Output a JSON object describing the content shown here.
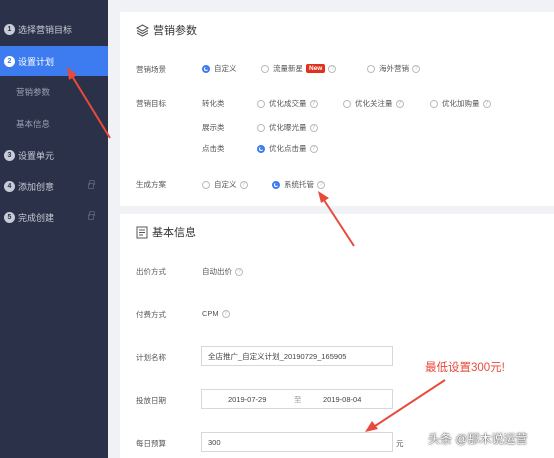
{
  "sidebar": {
    "items": [
      {
        "num": "1",
        "label": "选择营销目标"
      },
      {
        "num": "2",
        "label": "设置计划"
      },
      {
        "num": "3",
        "label": "设置单元"
      },
      {
        "num": "4",
        "label": "添加创意"
      },
      {
        "num": "5",
        "label": "完成创建"
      }
    ],
    "subitems": [
      {
        "label": "营销参数"
      },
      {
        "label": "基本信息"
      }
    ]
  },
  "marketing_params": {
    "title": "营销参数",
    "scene": {
      "label": "营销场景",
      "options": [
        {
          "label": "自定义",
          "checked": true
        },
        {
          "label": "流量新星",
          "checked": false,
          "badge": "New"
        },
        {
          "label": "海外营销",
          "checked": false
        }
      ]
    },
    "goal": {
      "label": "营销目标",
      "groups": [
        {
          "name": "转化类",
          "options": [
            "优化成交量",
            "优化关注量",
            "优化加购量"
          ]
        },
        {
          "name": "展示类",
          "options": [
            "优化曝光量"
          ]
        },
        {
          "name": "点击类",
          "options": [
            "优化点击量"
          ],
          "checked_index": 0
        }
      ]
    },
    "plan": {
      "label": "生成方案",
      "options": [
        {
          "label": "自定义",
          "checked": false
        },
        {
          "label": "系统托管",
          "checked": true
        }
      ]
    }
  },
  "basic_info": {
    "title": "基本信息",
    "bid_label": "出价方式",
    "bid_value": "自动出价",
    "pay_label": "付费方式",
    "pay_value": "CPM",
    "plan_name_label": "计划名称",
    "plan_name_value": "全店推广_自定义计划_20190729_165905",
    "date_label": "投放日期",
    "date_start": "2019-07-29",
    "date_sep": "至",
    "date_end": "2019-08-04",
    "budget_label": "每日预算",
    "budget_value": "300",
    "budget_unit": "元"
  },
  "annotation": {
    "text": "最低设置300元!",
    "color": "#e84a3b"
  },
  "watermark": {
    "text": "头条 @那木说运营"
  },
  "colors": {
    "sidebar_bg": "#2b3148",
    "accent": "#3d7cf0",
    "new_badge": "#e0301e",
    "arrow": "#e84a3b"
  }
}
